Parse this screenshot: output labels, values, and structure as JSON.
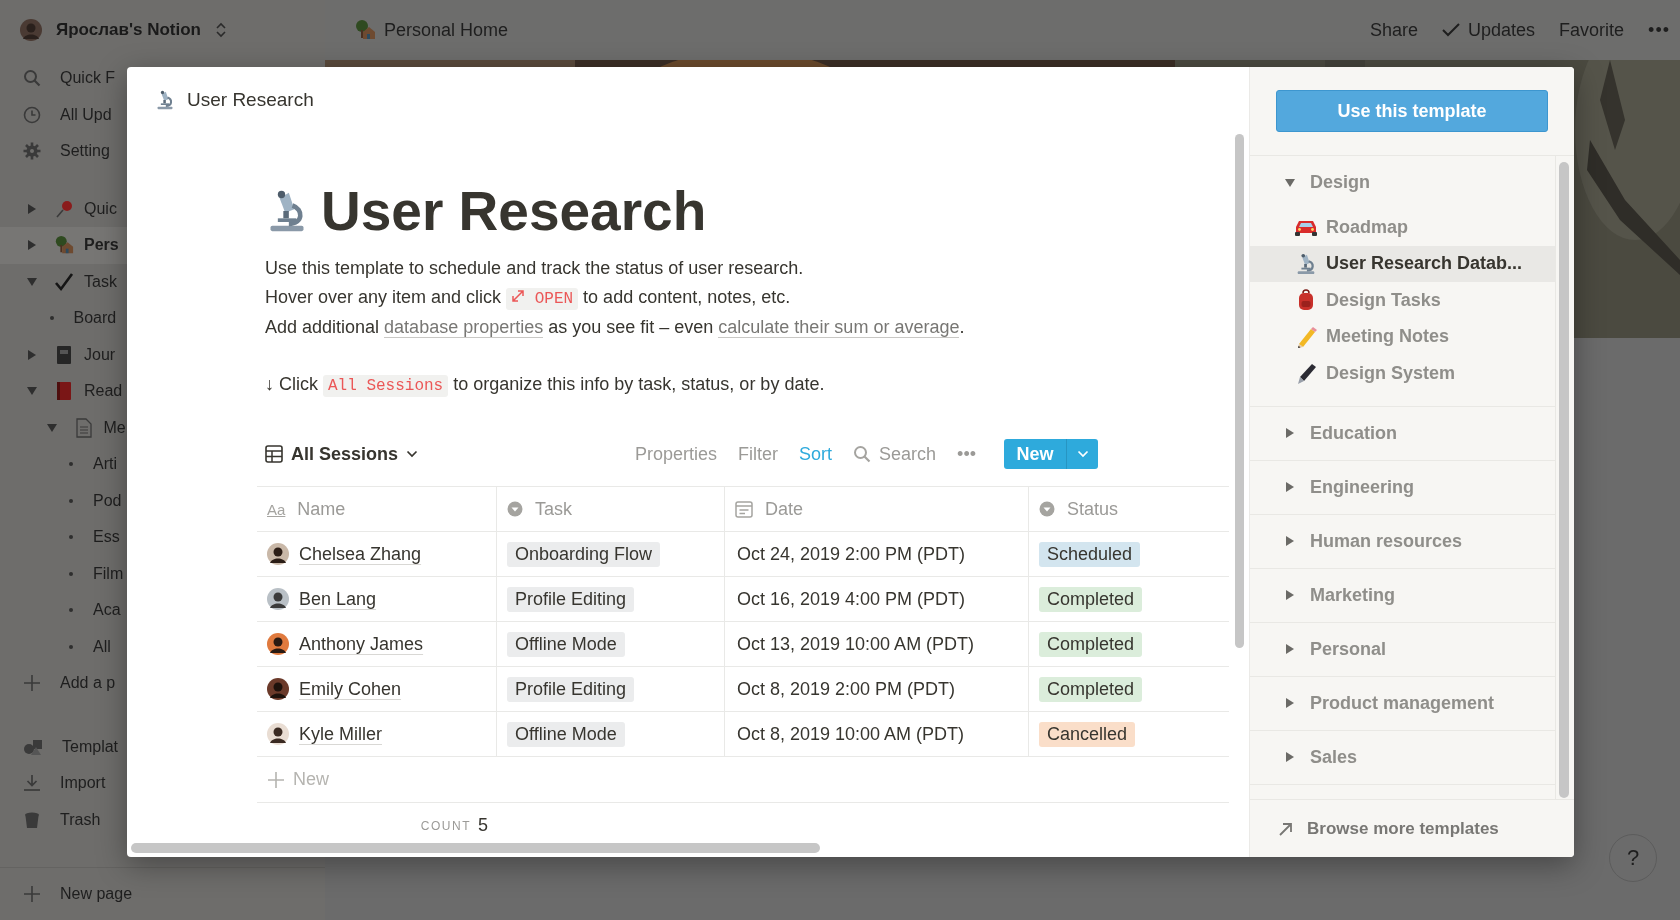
{
  "workspace": {
    "name": "Ярослав's Notion"
  },
  "sidebar": {
    "nav": [
      {
        "label": "Quick F"
      },
      {
        "label": "All Upd"
      },
      {
        "label": "Setting"
      }
    ],
    "tree": [
      {
        "label": "Quic",
        "selected": false,
        "expanded": false
      },
      {
        "label": "Pers",
        "selected": true,
        "expanded": false
      },
      {
        "label": "Task",
        "selected": false,
        "expanded": true,
        "children": [
          {
            "label": "Board",
            "selected": false
          }
        ]
      },
      {
        "label": "Jour",
        "selected": false,
        "expanded": false
      },
      {
        "label": "Read",
        "selected": false,
        "expanded": true,
        "children": [
          {
            "label": "Me",
            "selected": false,
            "expanded": true,
            "children": [
              {
                "label": "Arti",
                "selected": false
              },
              {
                "label": "Pod",
                "selected": false
              },
              {
                "label": "Ess",
                "selected": false
              },
              {
                "label": "Film",
                "selected": false
              },
              {
                "label": "Aca",
                "selected": false
              },
              {
                "label": "All",
                "selected": false
              }
            ]
          }
        ]
      }
    ],
    "add_page": "Add a p",
    "tools": [
      {
        "label": "Templat"
      },
      {
        "label": "Import"
      },
      {
        "label": "Trash"
      }
    ],
    "new_page": "New page"
  },
  "topbar": {
    "breadcrumb": "Personal Home",
    "actions": [
      {
        "label": "Share",
        "kind": "plain"
      },
      {
        "label": "Updates",
        "kind": "check"
      },
      {
        "label": "Favorite",
        "kind": "plain"
      }
    ],
    "more": "•••"
  },
  "template_preview": {
    "header_title": "User Research",
    "title": "User Research",
    "description": [
      [
        {
          "text": "Use this template to schedule and track the status of user research.",
          "kind": "text"
        }
      ],
      [
        {
          "text": "Hover over any item and click ",
          "kind": "text"
        },
        {
          "text": "OPEN",
          "kind": "open_chip"
        },
        {
          "text": " to add content, notes, etc.",
          "kind": "text"
        }
      ],
      [
        {
          "text": "Add additional ",
          "kind": "text"
        },
        {
          "text": "database properties",
          "kind": "link"
        },
        {
          "text": " as you see fit – even ",
          "kind": "text"
        },
        {
          "text": "calculate their sum or average",
          "kind": "link"
        },
        {
          "text": ".",
          "kind": "text"
        }
      ]
    ],
    "hint": [
      {
        "text": "↓ Click ",
        "kind": "text"
      },
      {
        "text": "All Sessions",
        "kind": "code"
      },
      {
        "text": " to organize this info by task, status, or by date.",
        "kind": "text"
      }
    ],
    "database": {
      "view": "All Sessions",
      "toolbar": [
        {
          "label": "Properties",
          "active": false
        },
        {
          "label": "Filter",
          "active": false
        },
        {
          "label": "Sort",
          "active": true
        }
      ],
      "search": "Search",
      "more": "•••",
      "new_button": "New",
      "columns": [
        {
          "label": "Name",
          "kind": "title",
          "glyph": "Aa"
        },
        {
          "label": "Task",
          "kind": "select"
        },
        {
          "label": "Date",
          "kind": "date"
        },
        {
          "label": "Status",
          "kind": "select"
        }
      ],
      "rows": [
        {
          "name": "Chelsea Zhang",
          "task": "Onboarding Flow",
          "date": "Oct 24, 2019 2:00 PM (PDT)",
          "status": {
            "label": "Scheduled",
            "color": "#d3e5ef"
          }
        },
        {
          "name": "Ben Lang",
          "task": "Profile Editing",
          "date": "Oct 16, 2019 4:00 PM (PDT)",
          "status": {
            "label": "Completed",
            "color": "#dbeddb"
          }
        },
        {
          "name": "Anthony James",
          "task": "Offline Mode",
          "date": "Oct 13, 2019 10:00 AM (PDT)",
          "status": {
            "label": "Completed",
            "color": "#dbeddb"
          }
        },
        {
          "name": "Emily Cohen",
          "task": "Profile Editing",
          "date": "Oct 8, 2019 2:00 PM (PDT)",
          "status": {
            "label": "Completed",
            "color": "#dbeddb"
          }
        },
        {
          "name": "Kyle Miller",
          "task": "Offline Mode",
          "date": "Oct 8, 2019 10:00 AM (PDT)",
          "status": {
            "label": "Cancelled",
            "color": "#fadec9"
          }
        }
      ],
      "new_row": "New",
      "count": {
        "label": "COUNT",
        "value": "5"
      }
    }
  },
  "template_picker": {
    "use_button": "Use this template",
    "categories": [
      {
        "label": "Design",
        "expanded": true,
        "templates": [
          {
            "label": "Roadmap",
            "selected": false
          },
          {
            "label": "User Research Datab...",
            "selected": true
          },
          {
            "label": "Design Tasks",
            "selected": false
          },
          {
            "label": "Meeting Notes",
            "selected": false
          },
          {
            "label": "Design System",
            "selected": false
          }
        ]
      },
      {
        "label": "Education",
        "expanded": false
      },
      {
        "label": "Engineering",
        "expanded": false
      },
      {
        "label": "Human resources",
        "expanded": false
      },
      {
        "label": "Marketing",
        "expanded": false
      },
      {
        "label": "Personal",
        "expanded": false
      },
      {
        "label": "Product management",
        "expanded": false
      },
      {
        "label": "Sales",
        "expanded": false
      }
    ],
    "browse": "Browse more templates"
  },
  "help_button": "?"
}
